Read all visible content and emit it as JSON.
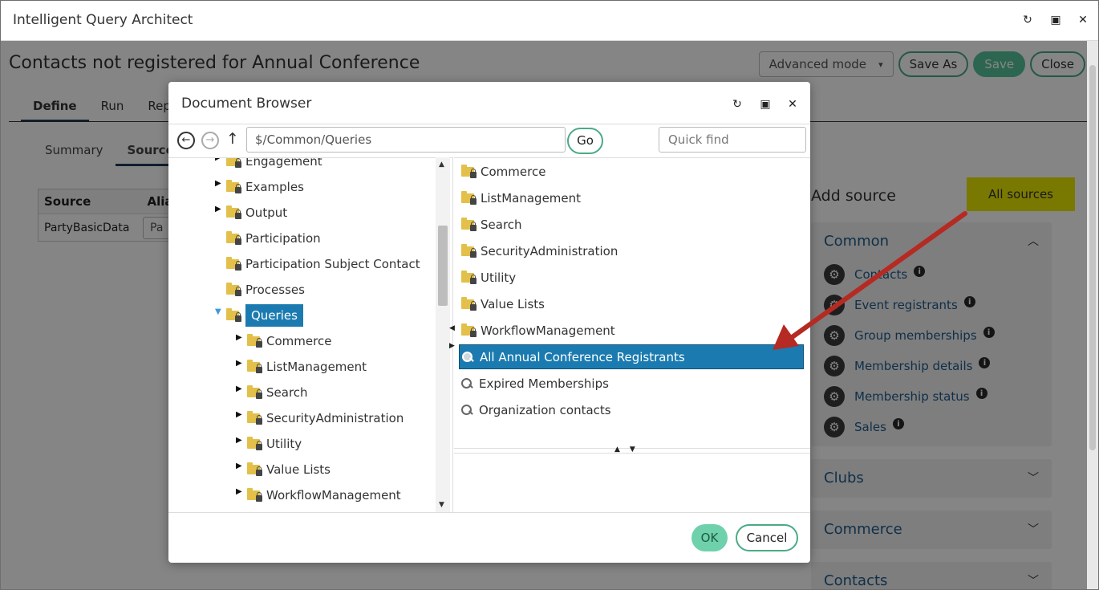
{
  "window": {
    "title": "Intelligent Query Architect"
  },
  "app": {
    "title": "Contacts not registered for Annual Conference",
    "mode_select": "Advanced mode",
    "buttons": {
      "save_as": "Save As",
      "save": "Save",
      "close": "Close"
    },
    "tabs": [
      "Define",
      "Run",
      "Repo"
    ],
    "subtabs": [
      "Summary",
      "Source"
    ],
    "sources_table": {
      "headers": [
        "Source",
        "Alia"
      ],
      "rows": [
        {
          "source": "PartyBasicData",
          "alias": "Pa"
        }
      ]
    },
    "add_source": {
      "title": "Add source",
      "filter_button": "All sources",
      "groups": [
        {
          "name": "Common",
          "items": [
            "Contacts",
            "Event registrants",
            "Group memberships",
            "Membership details",
            "Membership status",
            "Sales"
          ]
        },
        {
          "name": "Clubs"
        },
        {
          "name": "Commerce"
        },
        {
          "name": "Contacts"
        }
      ]
    }
  },
  "dialog": {
    "title": "Document Browser",
    "path": "$/Common/Queries",
    "go_label": "Go",
    "quick_find_placeholder": "Quick find",
    "tree": [
      {
        "label": "Engagement",
        "expander": "▶",
        "indent": 0
      },
      {
        "label": "Examples",
        "expander": "▶",
        "indent": 0
      },
      {
        "label": "Output",
        "expander": "▶",
        "indent": 0
      },
      {
        "label": "Participation",
        "expander": "",
        "indent": 0
      },
      {
        "label": "Participation Subject Contact",
        "expander": "",
        "indent": 0
      },
      {
        "label": "Processes",
        "expander": "",
        "indent": 0
      },
      {
        "label": "Queries",
        "expander": "▼",
        "indent": 0,
        "selected": true
      },
      {
        "label": "Commerce",
        "expander": "▶",
        "indent": 1
      },
      {
        "label": "ListManagement",
        "expander": "▶",
        "indent": 1
      },
      {
        "label": "Search",
        "expander": "▶",
        "indent": 1
      },
      {
        "label": "SecurityAdministration",
        "expander": "▶",
        "indent": 1
      },
      {
        "label": "Utility",
        "expander": "▶",
        "indent": 1
      },
      {
        "label": "Value Lists",
        "expander": "▶",
        "indent": 1
      },
      {
        "label": "WorkflowManagement",
        "expander": "▶",
        "indent": 1
      }
    ],
    "list": [
      {
        "label": "Commerce",
        "kind": "folder"
      },
      {
        "label": "ListManagement",
        "kind": "folder"
      },
      {
        "label": "Search",
        "kind": "folder"
      },
      {
        "label": "SecurityAdministration",
        "kind": "folder"
      },
      {
        "label": "Utility",
        "kind": "folder"
      },
      {
        "label": "Value Lists",
        "kind": "folder"
      },
      {
        "label": "WorkflowManagement",
        "kind": "folder"
      },
      {
        "label": "All Annual Conference Registrants",
        "kind": "query",
        "selected": true
      },
      {
        "label": "Expired Memberships",
        "kind": "query"
      },
      {
        "label": "Organization contacts",
        "kind": "query"
      }
    ],
    "ok_label": "OK",
    "cancel_label": "Cancel"
  },
  "colors": {
    "selection": "#1b7bb0",
    "accent_green": "#55c49a",
    "highlight_yellow": "#e9e600",
    "arrow_red": "#b52a22",
    "link_blue": "#1f5b8a"
  }
}
